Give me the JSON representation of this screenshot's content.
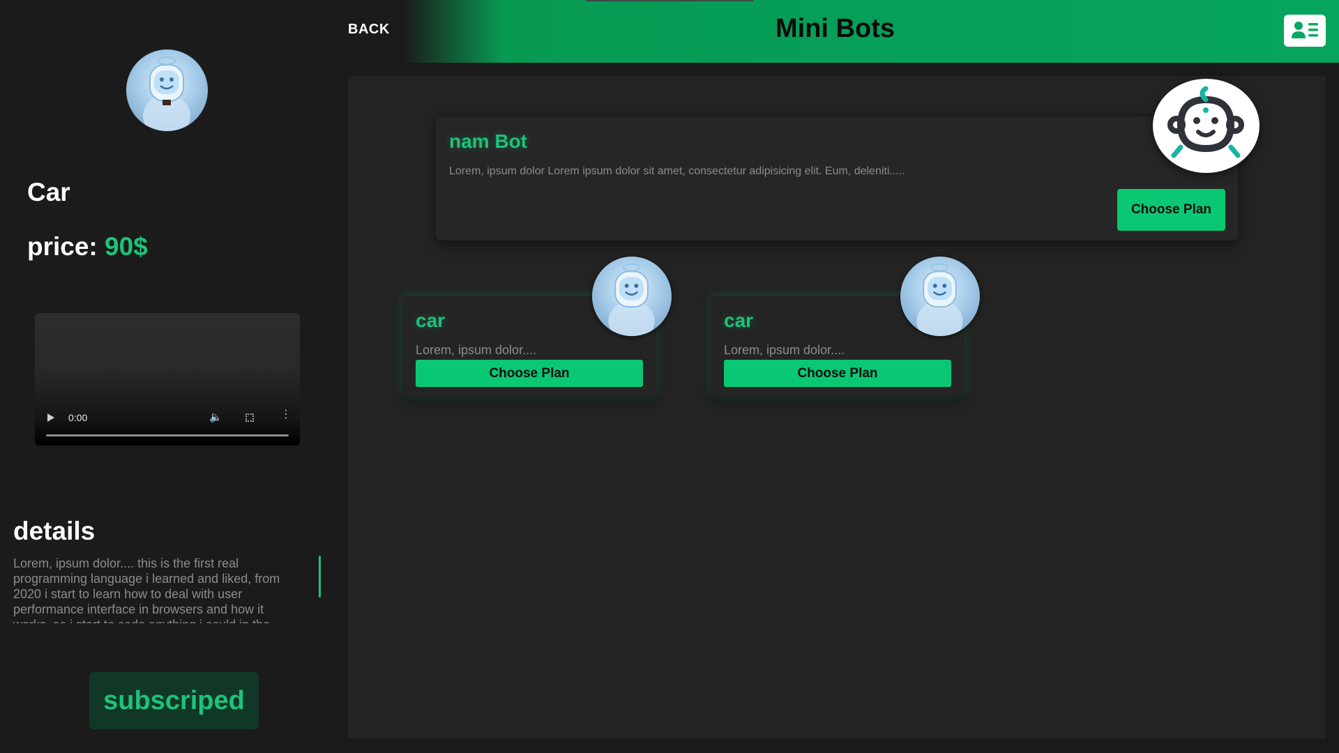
{
  "sidebar": {
    "product_name": "Car",
    "price_label": "price:",
    "price_value": "90$",
    "video": {
      "time": "0:00"
    },
    "details_title": "details",
    "details_text": "Lorem, ipsum dolor.... this is the first real programming language i learned and liked, from 2020 i start to learn how to deal with user performance interface in browsers and how it works, so i start to code anything i could in the",
    "subscribed_label": "subscriped"
  },
  "header": {
    "back_label": "BACK",
    "title": "Mini Bots"
  },
  "featured": {
    "title": "nam Bot",
    "description": "Lorem, ipsum dolor Lorem ipsum dolor sit amet, consectetur adipisicing elit. Eum, deleniti.....",
    "button_label": "Choose Plan"
  },
  "cards": [
    {
      "title": "car",
      "description": "Lorem, ipsum dolor....",
      "button_label": "Choose Plan"
    },
    {
      "title": "car",
      "description": "Lorem, ipsum dolor....",
      "button_label": "Choose Plan"
    }
  ],
  "colors": {
    "accent": "#1ec27a",
    "button": "#0ac774",
    "header_green": "#05a05a",
    "background": "#1a1a1a",
    "panel": "#232323"
  },
  "icons": [
    "robot-avatar-icon",
    "baby-face-icon",
    "profile-card-icon",
    "play-icon",
    "volume-icon",
    "fullscreen-icon",
    "more-vertical-icon"
  ]
}
